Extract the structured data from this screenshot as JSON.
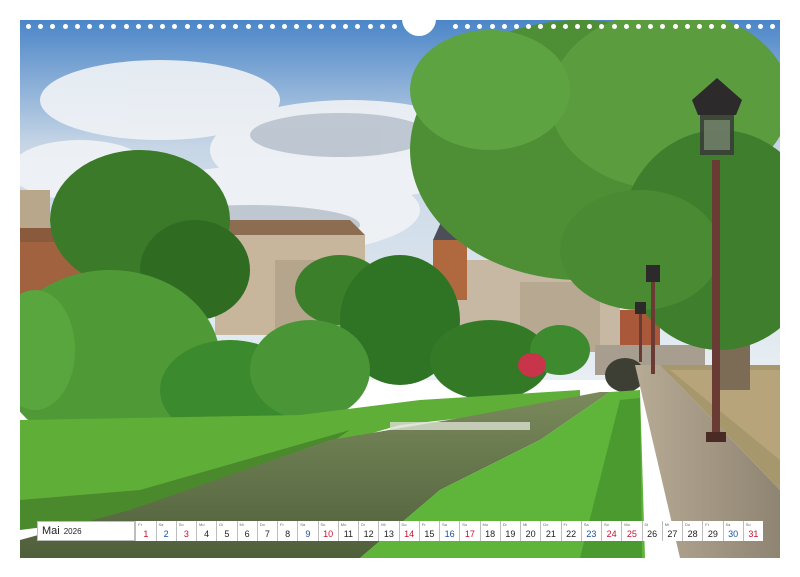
{
  "calendar": {
    "month": "Mai",
    "year": "2026",
    "days": [
      {
        "d": "1",
        "n": "Fr",
        "t": "hol"
      },
      {
        "d": "2",
        "n": "Sa",
        "t": "sat"
      },
      {
        "d": "3",
        "n": "So",
        "t": "sun"
      },
      {
        "d": "4",
        "n": "Mo",
        "t": ""
      },
      {
        "d": "5",
        "n": "Di",
        "t": ""
      },
      {
        "d": "6",
        "n": "Mi",
        "t": ""
      },
      {
        "d": "7",
        "n": "Do",
        "t": ""
      },
      {
        "d": "8",
        "n": "Fr",
        "t": ""
      },
      {
        "d": "9",
        "n": "Sa",
        "t": "sat"
      },
      {
        "d": "10",
        "n": "So",
        "t": "sun"
      },
      {
        "d": "11",
        "n": "Mo",
        "t": ""
      },
      {
        "d": "12",
        "n": "Di",
        "t": ""
      },
      {
        "d": "13",
        "n": "Mi",
        "t": ""
      },
      {
        "d": "14",
        "n": "Do",
        "t": "hol"
      },
      {
        "d": "15",
        "n": "Fr",
        "t": ""
      },
      {
        "d": "16",
        "n": "Sa",
        "t": "sat"
      },
      {
        "d": "17",
        "n": "So",
        "t": "sun"
      },
      {
        "d": "18",
        "n": "Mo",
        "t": ""
      },
      {
        "d": "19",
        "n": "Di",
        "t": ""
      },
      {
        "d": "20",
        "n": "Mi",
        "t": ""
      },
      {
        "d": "21",
        "n": "Do",
        "t": ""
      },
      {
        "d": "22",
        "n": "Fr",
        "t": ""
      },
      {
        "d": "23",
        "n": "Sa",
        "t": "sat"
      },
      {
        "d": "24",
        "n": "So",
        "t": "sun"
      },
      {
        "d": "25",
        "n": "Mo",
        "t": "hol"
      },
      {
        "d": "26",
        "n": "Di",
        "t": ""
      },
      {
        "d": "27",
        "n": "Mi",
        "t": ""
      },
      {
        "d": "28",
        "n": "Do",
        "t": ""
      },
      {
        "d": "29",
        "n": "Fr",
        "t": ""
      },
      {
        "d": "30",
        "n": "Sa",
        "t": "sat"
      },
      {
        "d": "31",
        "n": "So",
        "t": "sun"
      }
    ]
  },
  "colors": {
    "sky": "#cfdbe8",
    "foliage": "#3f8a2e",
    "grass": "#69b83c",
    "water": "#5d6b43",
    "holiday": "#c8102e",
    "saturday": "#1a4fa0"
  }
}
